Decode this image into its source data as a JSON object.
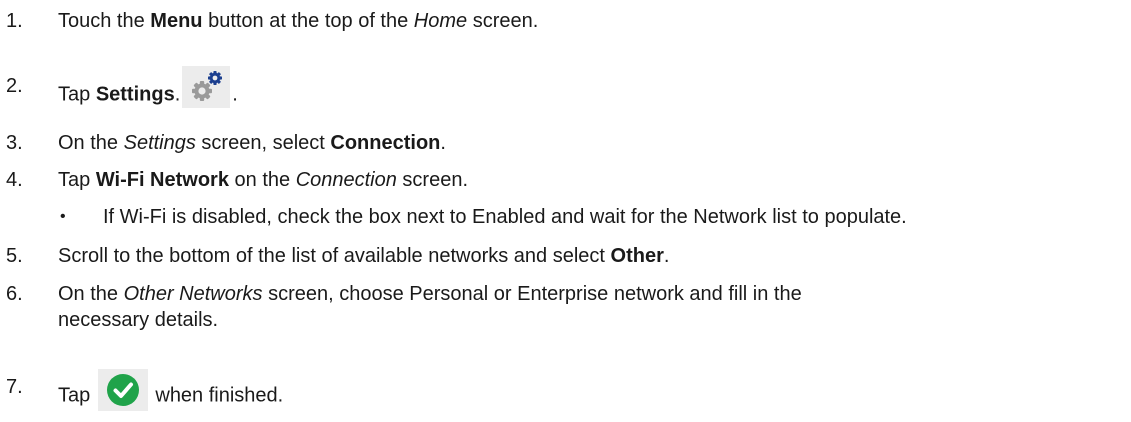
{
  "steps": [
    {
      "num": "1.",
      "parts": [
        "Touch the ",
        "Menu",
        " button at the top of the ",
        "Home",
        " screen."
      ]
    },
    {
      "num": "2.",
      "parts": [
        "Tap ",
        "Settings",
        ".",
        "."
      ]
    },
    {
      "num": "3.",
      "parts": [
        "On the ",
        "Settings",
        " screen, select ",
        "Connection",
        "."
      ]
    },
    {
      "num": "4.",
      "parts": [
        "Tap ",
        "Wi-Fi Network",
        " on the ",
        "Connection",
        " screen."
      ]
    },
    {
      "num": "5.",
      "parts": [
        "Scroll to the bottom of the list of available networks and select ",
        "Other",
        "."
      ]
    },
    {
      "num": "6.",
      "parts": [
        "On the ",
        "Other Networks",
        " screen, choose Personal or Enterprise network and fill in the",
        "necessary details."
      ]
    },
    {
      "num": "7.",
      "parts": [
        "Tap ",
        " when finished."
      ]
    }
  ],
  "bullet": {
    "symbol": "•",
    "text": "If Wi-Fi is disabled, check the box next to Enabled and wait for the Network list to populate."
  },
  "icons": {
    "settings": "gear-icon",
    "confirm": "checkmark-icon"
  },
  "colors": {
    "gear_gray": "#9a9a9a",
    "gear_blue": "#1c3f8f",
    "check_green": "#20a34a",
    "icon_bg": "#ececec"
  }
}
